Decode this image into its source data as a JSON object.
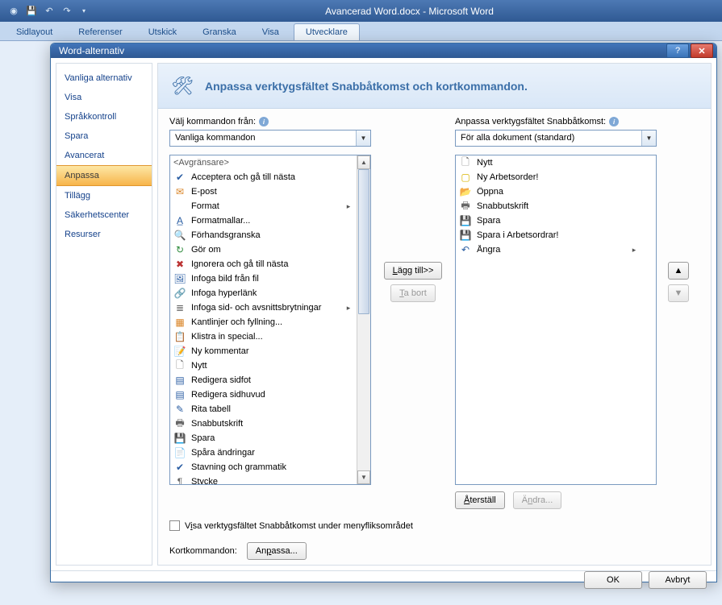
{
  "app_title": "Avancerad Word.docx - Microsoft Word",
  "ribbon_tabs": [
    "Sidlayout",
    "Referenser",
    "Utskick",
    "Granska",
    "Visa",
    "Utvecklare"
  ],
  "dialog": {
    "title": "Word-alternativ",
    "sidebar": [
      "Vanliga alternativ",
      "Visa",
      "Språkkontroll",
      "Spara",
      "Avancerat",
      "Anpassa",
      "Tillägg",
      "Säkerhetscenter",
      "Resurser"
    ],
    "sidebar_selected": 5,
    "header": "Anpassa verktygsfältet Snabbåtkomst och kortkommandon.",
    "left_label": "Välj kommandon från:",
    "left_combo": "Vanliga kommandon",
    "right_label": "Anpassa verktygsfältet Snabbåtkomst:",
    "right_combo": "För alla dokument (standard)",
    "left_list": [
      {
        "label": "<Avgränsare>",
        "sep": true
      },
      {
        "label": "Acceptera och gå till nästa",
        "icon": "✔",
        "cls": "ic-blue"
      },
      {
        "label": "E-post",
        "icon": "✉",
        "cls": "ic-orange"
      },
      {
        "label": "Format",
        "icon": "",
        "arrow": true
      },
      {
        "label": "Formatmallar...",
        "icon": "A̲",
        "cls": "ic-blue"
      },
      {
        "label": "Förhandsgranska",
        "icon": "🔍",
        "cls": "ic-blue"
      },
      {
        "label": "Gör om",
        "icon": "↻",
        "cls": "ic-green"
      },
      {
        "label": "Ignorera och gå till nästa",
        "icon": "✖",
        "cls": "ic-red"
      },
      {
        "label": "Infoga bild från fil",
        "icon": "🖼",
        "cls": "ic-blue"
      },
      {
        "label": "Infoga hyperlänk",
        "icon": "🔗",
        "cls": "ic-blue"
      },
      {
        "label": "Infoga sid- och avsnittsbrytningar",
        "icon": "≣",
        "cls": "ic-gray",
        "arrow": true
      },
      {
        "label": "Kantlinjer och fyllning...",
        "icon": "▦",
        "cls": "ic-orange"
      },
      {
        "label": "Klistra in special...",
        "icon": "📋",
        "cls": "ic-orange"
      },
      {
        "label": "Ny kommentar",
        "icon": "📝",
        "cls": "ic-orange"
      },
      {
        "label": "Nytt",
        "icon": "🗋",
        "cls": "ic-gray"
      },
      {
        "label": "Redigera sidfot",
        "icon": "▤",
        "cls": "ic-blue"
      },
      {
        "label": "Redigera sidhuvud",
        "icon": "▤",
        "cls": "ic-blue"
      },
      {
        "label": "Rita tabell",
        "icon": "✎",
        "cls": "ic-blue"
      },
      {
        "label": "Snabbutskrift",
        "icon": "🖶",
        "cls": "ic-gray"
      },
      {
        "label": "Spara",
        "icon": "💾",
        "cls": "ic-save"
      },
      {
        "label": "Spåra ändringar",
        "icon": "📄",
        "cls": "ic-blue"
      },
      {
        "label": "Stavning och grammatik",
        "icon": "✔",
        "cls": "ic-blue"
      },
      {
        "label": "Stycke",
        "icon": "¶",
        "cls": "ic-gray"
      }
    ],
    "right_list": [
      {
        "label": "Nytt",
        "icon": "🗋",
        "cls": "ic-gray"
      },
      {
        "label": "Ny Arbetsorder!",
        "icon": "▢",
        "cls": "ic-yellow"
      },
      {
        "label": "Öppna",
        "icon": "📂",
        "cls": "ic-orange"
      },
      {
        "label": "Snabbutskrift",
        "icon": "🖶",
        "cls": "ic-gray"
      },
      {
        "label": "Spara",
        "icon": "💾",
        "cls": "ic-save"
      },
      {
        "label": "Spara i Arbetsordrar!",
        "icon": "💾",
        "cls": "ic-save"
      },
      {
        "label": "Ångra",
        "icon": "↶",
        "cls": "ic-blue",
        "arrow": true
      }
    ],
    "add_btn": "Lägg till>>",
    "remove_btn": "Ta bort",
    "reset_btn": "Återställ",
    "modify_btn": "Ändra...",
    "checkbox_label": "Visa verktygsfältet Snabbåtkomst under menyfliksområdet",
    "shortcuts_label": "Kortkommandon:",
    "customize_btn": "Anpassa...",
    "ok_btn": "OK",
    "cancel_btn": "Avbryt"
  }
}
